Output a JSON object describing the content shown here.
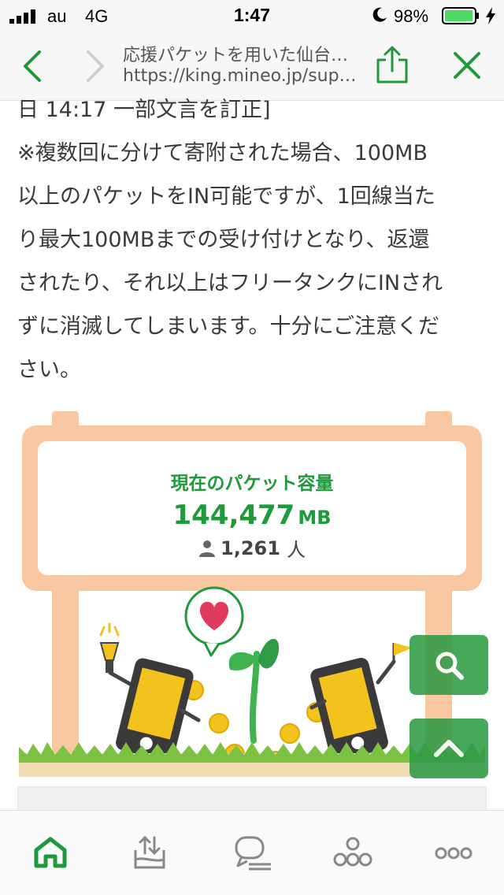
{
  "status_bar": {
    "carrier": "au",
    "network": "4G",
    "time": "1:47",
    "battery_percent": "98%",
    "battery_level": 0.98
  },
  "toolbar": {
    "page_title": "応援パケットを用いた仙台…",
    "url": "https://king.mineo.jp/sup…"
  },
  "article": {
    "lines": [
      "日 14:17 一部文言を訂正]",
      "※複数回に分けて寄附された場合、100MB",
      "以上のパケットをIN可能ですが、1回線当た",
      "り最大100MBまでの受け付けとなり、返還",
      "されたり、それ以上はフリータンクにINされ",
      "ずに消滅してしまいます。十分にご注意くだ",
      "さい。"
    ]
  },
  "packet_board": {
    "label": "現在のパケット容量",
    "value": "144,477",
    "value_unit": "MB",
    "users": "1,261",
    "users_unit": "人"
  },
  "colors": {
    "accent_green": "#1f9a3a",
    "board_peach": "#fac8a0",
    "fab_green": "#2e9b45"
  },
  "icons": {
    "fab_search": "search-icon",
    "fab_top": "chevron-up-icon",
    "tabs": [
      "home-icon",
      "upload-icon",
      "chat-icon",
      "community-icon",
      "more-icon"
    ]
  }
}
